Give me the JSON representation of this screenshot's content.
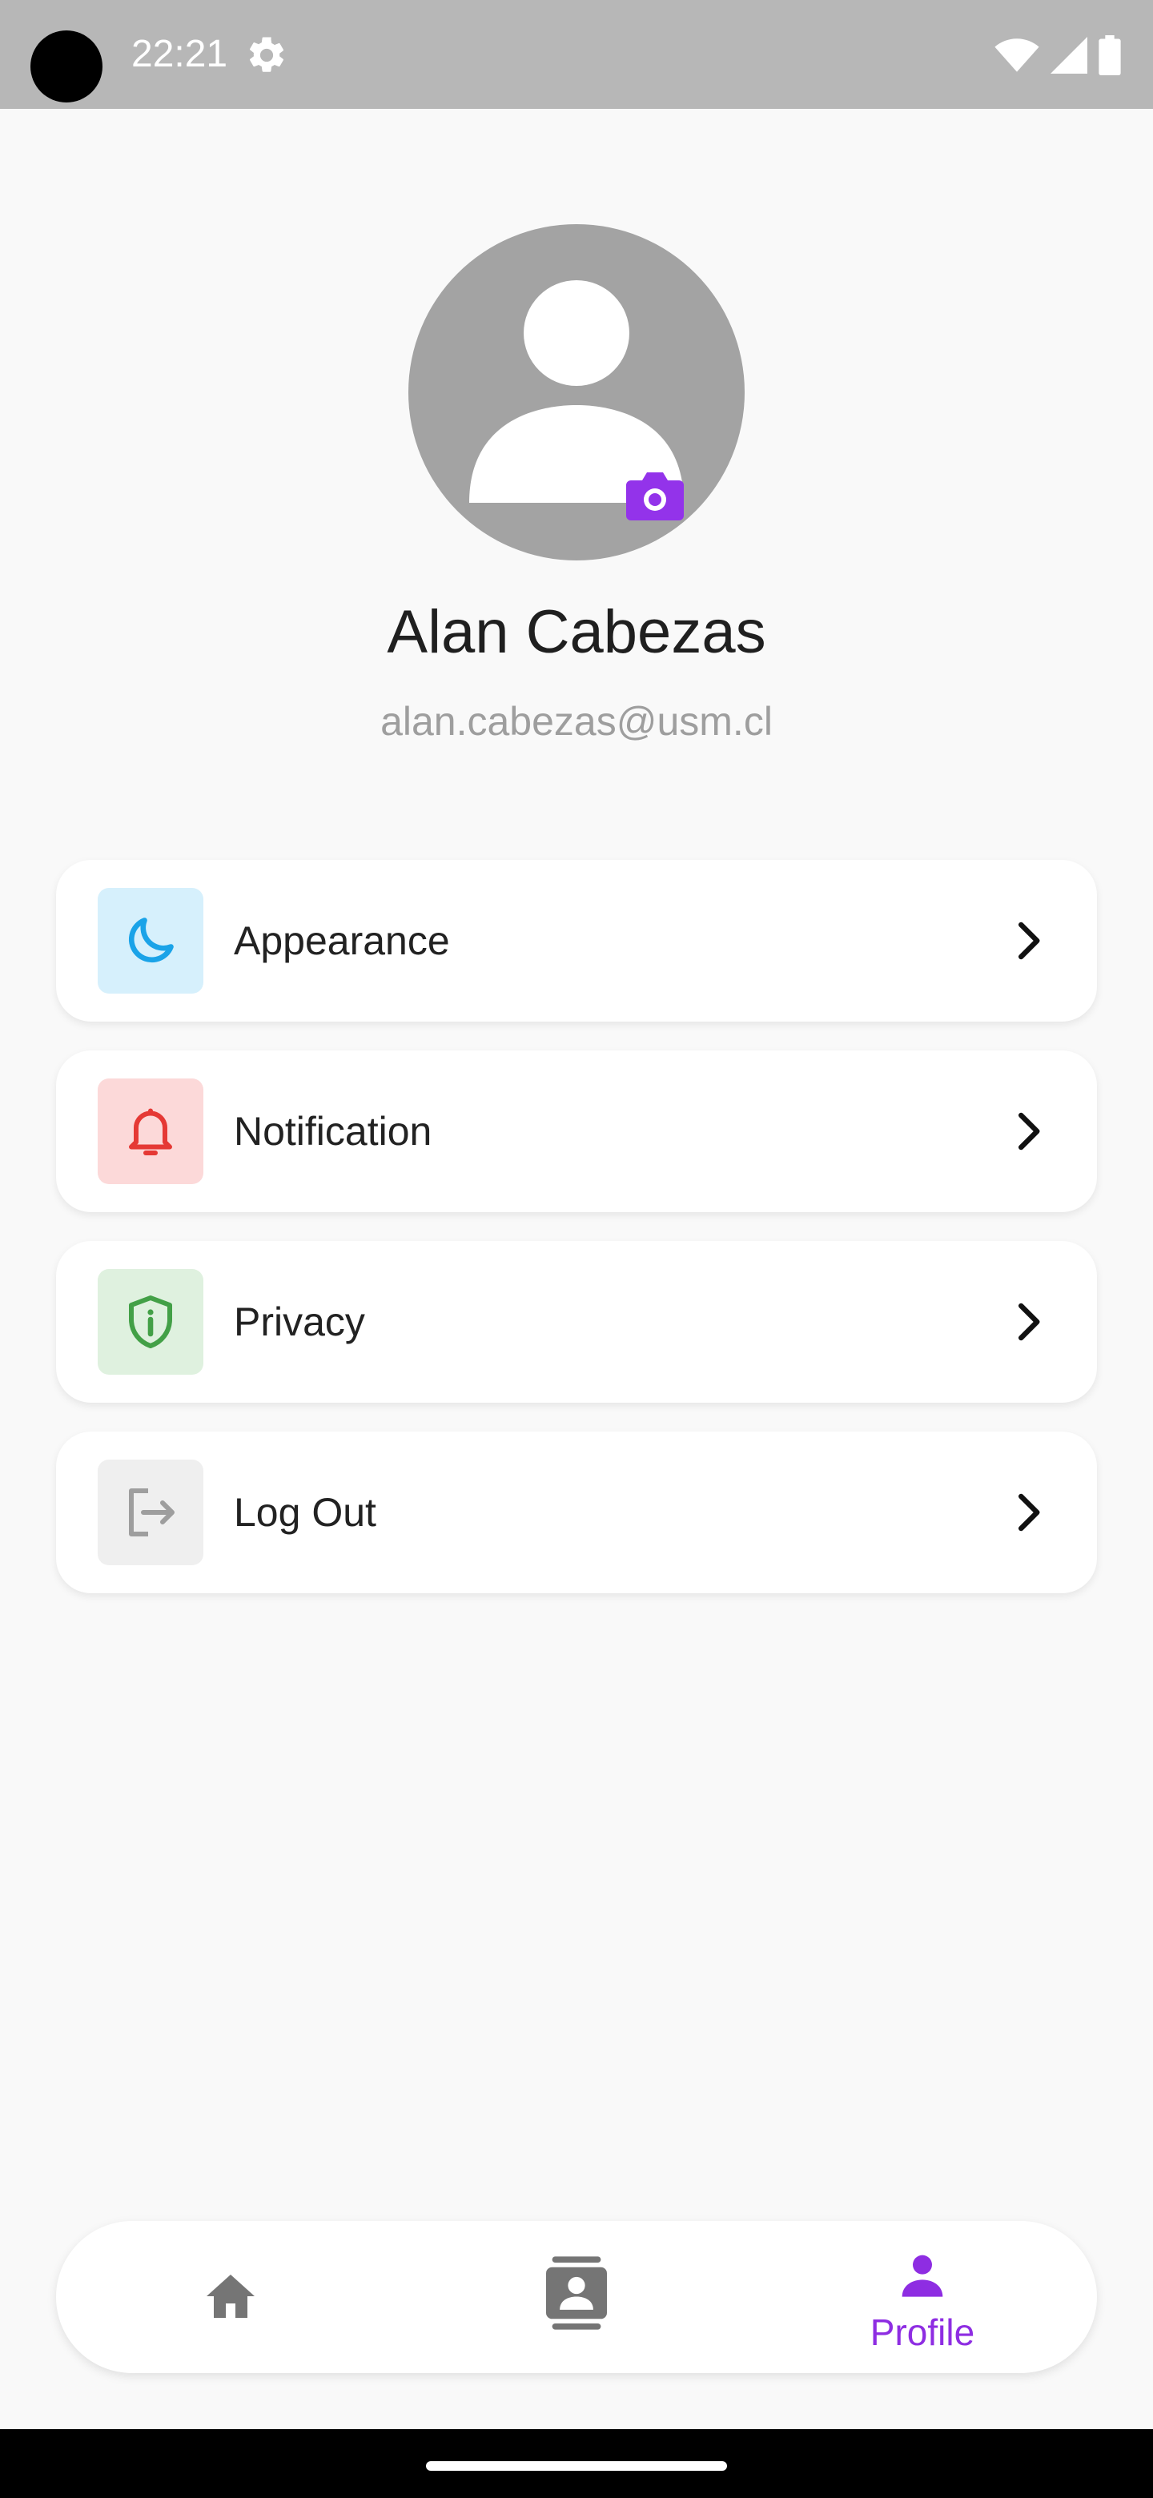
{
  "status_bar": {
    "time": "22:21",
    "icons": [
      "settings-icon",
      "wifi-icon",
      "signal-icon",
      "battery-icon"
    ]
  },
  "profile": {
    "name": "Alan Cabezas",
    "email": "alan.cabezas@usm.cl",
    "avatar_icon": "person-avatar-icon",
    "camera_icon": "camera-icon"
  },
  "menu": {
    "items": [
      {
        "label": "Appearance",
        "icon": "moon-icon",
        "icon_color": "#1aa3e8",
        "icon_bg": "#d6f0fc"
      },
      {
        "label": "Notification",
        "icon": "bell-icon",
        "icon_color": "#e53935",
        "icon_bg": "#fcd9d9"
      },
      {
        "label": "Privacy",
        "icon": "shield-icon",
        "icon_color": "#43a047",
        "icon_bg": "#dff1df"
      },
      {
        "label": "Log Out",
        "icon": "logout-icon",
        "icon_color": "#9e9e9e",
        "icon_bg": "#efefef"
      }
    ]
  },
  "bottom_nav": {
    "items": [
      {
        "icon": "home-icon",
        "active": false
      },
      {
        "icon": "contacts-icon",
        "active": false
      },
      {
        "icon": "profile-icon",
        "label": "Profile",
        "active": true
      }
    ],
    "active_color": "#8e2de2",
    "inactive_color": "#757575"
  }
}
